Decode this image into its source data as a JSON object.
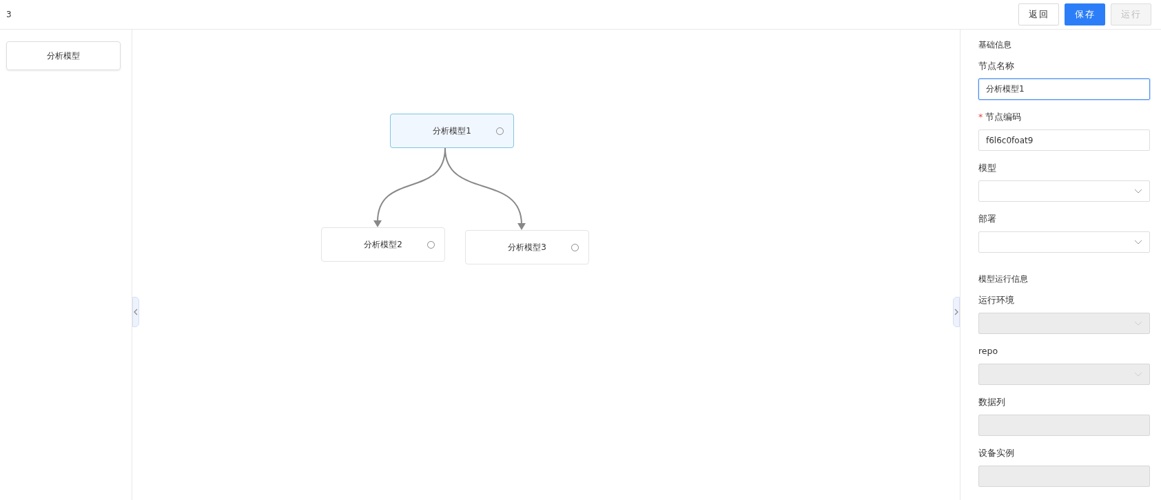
{
  "header": {
    "title": "3",
    "buttons": [
      {
        "label": "返回",
        "kind": "default",
        "disabled": false
      },
      {
        "label": "保存",
        "kind": "primary",
        "disabled": false
      },
      {
        "label": "运行",
        "kind": "default",
        "disabled": true
      }
    ]
  },
  "palette": {
    "items": [
      {
        "label": "分析模型"
      }
    ]
  },
  "canvas": {
    "nodes": [
      {
        "label": "分析模型1",
        "selected": true,
        "children": [
          {
            "label": "分析模型2",
            "selected": false
          },
          {
            "label": "分析模型3",
            "selected": false
          }
        ]
      }
    ]
  },
  "properties": {
    "sections": [
      {
        "title": "基础信息",
        "fields": [
          {
            "label": "节点名称",
            "kind": "input",
            "value": "分析模型1",
            "disabled": false,
            "focused": true
          },
          {
            "label": "节点编码",
            "kind": "input",
            "value": "f6l6c0foat9",
            "required_mark": "*",
            "disabled": false,
            "focused": false
          },
          {
            "label": "模型",
            "kind": "select",
            "disabled": false,
            "focused": false
          },
          {
            "label": "部署",
            "kind": "select",
            "disabled": false,
            "focused": false
          }
        ]
      },
      {
        "title": "模型运行信息",
        "fields": [
          {
            "label": "运行环境",
            "kind": "select",
            "disabled": true,
            "focused": false
          },
          {
            "label": "repo",
            "kind": "select",
            "disabled": true,
            "focused": false
          },
          {
            "label": "数据列",
            "kind": "input",
            "disabled": true,
            "focused": false
          },
          {
            "label": "设备实例",
            "kind": "input",
            "disabled": true,
            "focused": false
          }
        ]
      }
    ]
  }
}
